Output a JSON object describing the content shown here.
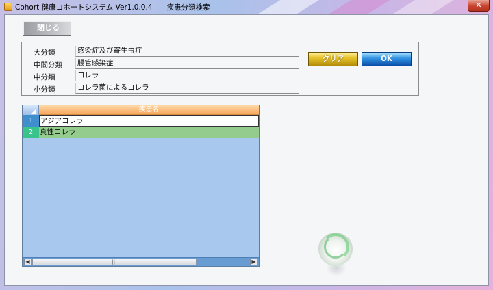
{
  "window": {
    "title": "Cohort 健康コホートシステム Ver1.0.0.4　　疾患分類検索",
    "close_glyph": "✕"
  },
  "toolbar": {
    "close_form_label": "閉じる"
  },
  "classification": {
    "rows": [
      {
        "label": "大分類",
        "value": "感染症及び寄生虫症"
      },
      {
        "label": "中間分類",
        "value": "腸管感染症"
      },
      {
        "label": "中分類",
        "value": "コレラ"
      },
      {
        "label": "小分類",
        "value": "コレラ菌によるコレラ"
      }
    ],
    "clear_label": "クリア",
    "ok_label": "OK"
  },
  "grid": {
    "column_header": "疾患名",
    "rows": [
      {
        "num": "1",
        "name": "アジアコレラ"
      },
      {
        "num": "2",
        "name": "真性コレラ"
      }
    ],
    "scroll_left_glyph": "◀",
    "scroll_right_glyph": "▶",
    "scroll_thumb_glyph": "|||"
  }
}
